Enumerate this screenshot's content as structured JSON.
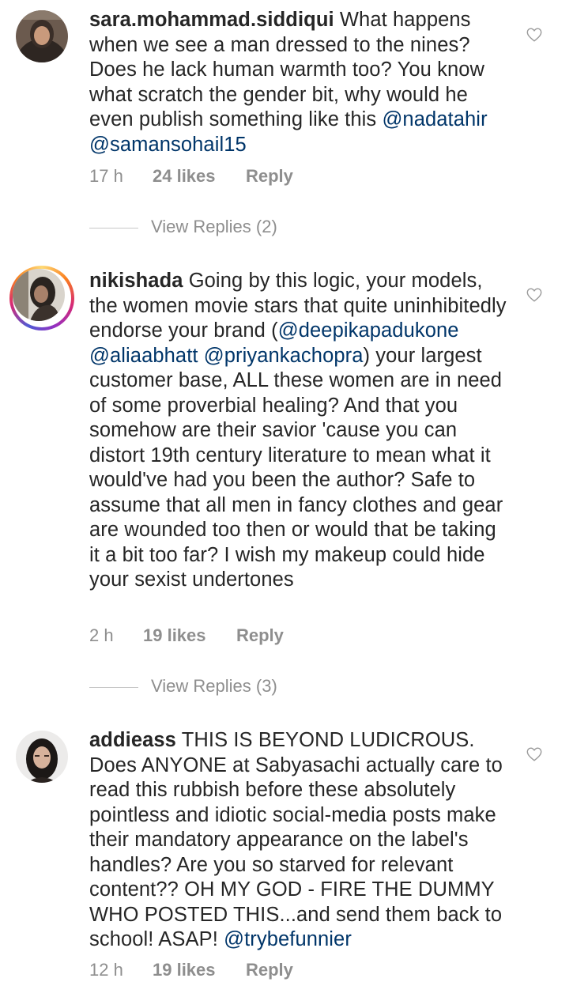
{
  "comments": [
    {
      "username": "sara.mohammad.siddiqui",
      "body": "What happens when we see a man dressed to the nines? Does he lack human warmth too? You know what scratch the gender bit, why would he even publish something like this ",
      "mentions": [
        "@nadatahir",
        "@samansohail15"
      ],
      "time": "17 h",
      "likes": "24 likes",
      "reply": "Reply",
      "view_replies": "View Replies (2)"
    },
    {
      "username": "nikishada",
      "body_start": "Going by this logic, your models, the women movie stars that quite uninhibitedly endorse your brand (",
      "mentions": [
        "@deepikapadukone",
        "@aliaabhatt",
        "@priyankachopra"
      ],
      "body_end": ") your largest customer base, ALL these women are in need of some proverbial healing? And that you somehow are their savior 'cause you can distort 19th century literature to mean what it would've had you been the author? Safe to assume that all men in fancy clothes and gear are wounded too then or would that be taking it a bit too far? I wish my makeup could hide your sexist undertones",
      "time": "2 h",
      "likes": "19 likes",
      "reply": "Reply",
      "view_replies": "View Replies (3)"
    },
    {
      "username": "addieass",
      "body": "THIS IS BEYOND LUDICROUS. Does ANYONE at Sabyasachi actually care to read this rubbish before these absolutely pointless and idiotic social-media posts make their mandatory appearance on the label's handles? Are you so starved for relevant content?? OH MY GOD - FIRE THE DUMMY WHO POSTED THIS...and send them back to school! ASAP! ",
      "mentions": [
        "@trybefunnier"
      ],
      "time": "12 h",
      "likes": "19 likes",
      "reply": "Reply"
    }
  ],
  "icons": {
    "like": "heart-outline-icon"
  },
  "colors": {
    "mention": "#003569",
    "meta": "#8e8e8e",
    "text": "#262626"
  }
}
